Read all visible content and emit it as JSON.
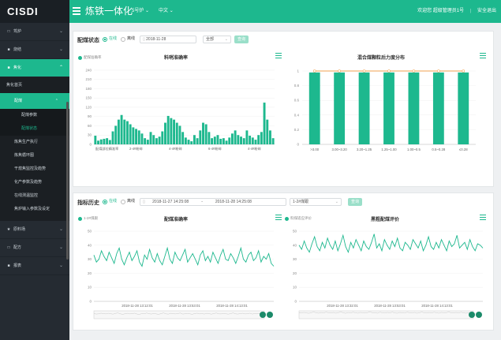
{
  "topbar": {
    "logo": "CISDI",
    "title": "炼铁一体化",
    "furnace": "5号炉",
    "language": "中文",
    "welcome": "欢迎您 超级管理员1号",
    "logout": "安全退出"
  },
  "sidebar": {
    "items": [
      {
        "label": "驾炉",
        "icon": "□"
      },
      {
        "label": "烧结",
        "icon": "■"
      },
      {
        "label": "焦化",
        "icon": "■"
      }
    ],
    "jiaohua_home": "焦化首页",
    "peimei": "配煤",
    "peimei_sub": [
      "配煤参数",
      "配煤状态"
    ],
    "leaves": [
      "炼焦生产执行",
      "炼焦循环图",
      "干熄焦监控及趋势",
      "化产参数及趋势",
      "在线测温监控",
      "焦炉输入参数及设定"
    ],
    "bottom": [
      {
        "label": "原料场",
        "icon": "★"
      },
      {
        "label": "配方",
        "icon": "□"
      },
      {
        "label": "报表",
        "icon": "■"
      }
    ]
  },
  "panel1": {
    "title": "配煤状态",
    "radio_online": "在线",
    "radio_offline": "离线",
    "date": "2018-11-28",
    "select": "全部",
    "button": "查询",
    "chart1": {
      "title": "料哨准确率",
      "legend": "配煤准确率"
    },
    "chart2": {
      "title": "混合煤颗粒后力度分布"
    }
  },
  "panel2": {
    "title": "指标历史",
    "radio_online": "在线",
    "radio_offline": "离线",
    "start": "2018-11-27 14:25:08",
    "sep": "-",
    "end": "2018-11-28 14:25:08",
    "select": "1-2#煤跟",
    "button": "查询",
    "chart3": {
      "title": "配煤准确率",
      "legend": "1-2#煤跟"
    },
    "chart4": {
      "title": "黑粗配煤评价",
      "legend": "料煤适应评价"
    }
  },
  "chart_data": [
    {
      "type": "bar",
      "title": "料哨准确率",
      "legend": "配煤准确率",
      "ylim": [
        0,
        250
      ],
      "yticks": [
        0,
        30,
        60,
        90,
        120,
        150,
        180,
        210,
        240
      ],
      "xticks": [
        "配煤部位精准率",
        "2-4#粉碎",
        "4-4#粉碎",
        "6-4#粉碎",
        "4-4#粉碎"
      ],
      "values": [
        28,
        12,
        16,
        18,
        20,
        14,
        42,
        60,
        80,
        95,
        80,
        75,
        65,
        55,
        50,
        45,
        35,
        20,
        15,
        40,
        30,
        20,
        25,
        42,
        70,
        92,
        85,
        80,
        70,
        60,
        40,
        22,
        15,
        10,
        30,
        20,
        45,
        70,
        65,
        40,
        20,
        25,
        30,
        18,
        20,
        12,
        22,
        35,
        45,
        30,
        25,
        20,
        45,
        28,
        22,
        15,
        30,
        40,
        135,
        80,
        45,
        20
      ]
    },
    {
      "type": "bar",
      "title": "混合煤颗粒后力度分布",
      "ylim": [
        0,
        1
      ],
      "yticks": [
        0,
        0.2,
        0.4,
        0.6,
        0.8,
        1
      ],
      "categories": [
        ">3.00",
        "3.00~3.20",
        "3.20~1.25",
        "1.25~1.00",
        "1.00~0.5",
        "0.5~0.28",
        "≤0.28"
      ],
      "values": [
        0.98,
        0.98,
        0.98,
        0.98,
        0.98,
        0.98,
        0.98
      ],
      "line": [
        1,
        1,
        1,
        1,
        1,
        1,
        1
      ]
    },
    {
      "type": "line",
      "title": "配煤准确率",
      "legend": "1-2#煤跟",
      "ylim": [
        0,
        50
      ],
      "yticks": [
        0,
        10,
        20,
        30,
        40,
        50
      ],
      "xticks": [
        "2018-11-28 13:12:01",
        "2018-11-28 13:53:01",
        "2018-11-28 14:13:01"
      ],
      "values": [
        33,
        28,
        30,
        36,
        32,
        29,
        35,
        31,
        27,
        34,
        38,
        30,
        26,
        31,
        35,
        29,
        32,
        36,
        28,
        25,
        33,
        30,
        37,
        31,
        28,
        34,
        29,
        26,
        32,
        38,
        30,
        27,
        35,
        31,
        29,
        33,
        37,
        28,
        31,
        34,
        30,
        26,
        33,
        36,
        29,
        32,
        28,
        35,
        31,
        27,
        33,
        37,
        30,
        29,
        34,
        31,
        27,
        32,
        38,
        30,
        28,
        33,
        35,
        29,
        31,
        36,
        28,
        32,
        30,
        34,
        27,
        25
      ]
    },
    {
      "type": "line",
      "title": "黑粗配煤评价",
      "legend": "料煤适应评价",
      "ylim": [
        0,
        50
      ],
      "yticks": [
        0,
        10,
        20,
        30,
        40,
        50
      ],
      "xticks": [
        "2018-11-28 13:32:01",
        "2018-11-28 13:53:01",
        "2018-11-28 14:13:01"
      ],
      "values": [
        40,
        37,
        43,
        38,
        35,
        41,
        46,
        39,
        36,
        42,
        38,
        45,
        40,
        37,
        43,
        36,
        41,
        47,
        39,
        35,
        42,
        38,
        44,
        40,
        36,
        43,
        39,
        37,
        42,
        48,
        38,
        41,
        36,
        44,
        40,
        37,
        43,
        39,
        45,
        38,
        36,
        42,
        40,
        37,
        44,
        41,
        38,
        43,
        36,
        40,
        46,
        39,
        37,
        42,
        38,
        44,
        40,
        36,
        43,
        39,
        41,
        47,
        38,
        40,
        42,
        37,
        44,
        39,
        36,
        41,
        40,
        38
      ]
    }
  ]
}
